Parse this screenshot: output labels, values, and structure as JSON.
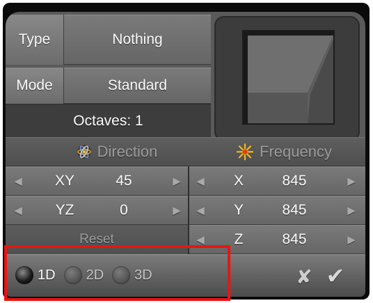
{
  "settings": {
    "type_label": "Type",
    "type_value": "Nothing",
    "mode_label": "Mode",
    "mode_value": "Standard",
    "octaves_text": "Octaves: 1"
  },
  "direction": {
    "header": "Direction",
    "icon": "atom-icon",
    "rows": [
      {
        "axis": "XY",
        "value": "45"
      },
      {
        "axis": "YZ",
        "value": "0"
      }
    ],
    "reset_label": "Reset"
  },
  "frequency": {
    "header": "Frequency",
    "icon": "burst-icon",
    "rows": [
      {
        "axis": "X",
        "value": "845"
      },
      {
        "axis": "Y",
        "value": "845"
      },
      {
        "axis": "Z",
        "value": "845"
      }
    ]
  },
  "dimensions": {
    "options": [
      "1D",
      "2D",
      "3D"
    ],
    "selected": "1D"
  },
  "actions": {
    "cancel_glyph": "✘",
    "confirm_glyph": "✔"
  },
  "colors": {
    "panel": "#5a5a5a",
    "highlight": "#ef1212",
    "preview_dark": "#0b0b0b"
  }
}
